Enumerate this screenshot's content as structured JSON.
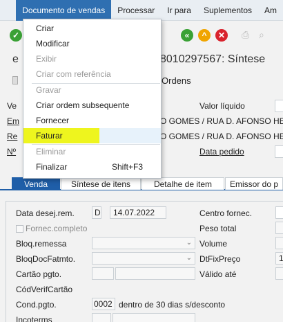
{
  "menubar": {
    "items": [
      {
        "label": "",
        "active": false
      },
      {
        "label": "Documento de vendas",
        "active": true
      },
      {
        "label": "Processar",
        "active": false
      },
      {
        "label": "Ir para",
        "active": false
      },
      {
        "label": "Suplementos",
        "active": false
      },
      {
        "label": "Am",
        "active": false
      }
    ]
  },
  "title": {
    "left": "e",
    "right": "8010297567: Síntese"
  },
  "appbar": {
    "ordens": "Ordens"
  },
  "header": {
    "valor_label": "Valor líquido",
    "emissor_value": "O GOMES / RUA D. AFONSO HE",
    "recebedor_value": "O GOMES / RUA D. AFONSO HE",
    "data_pedido_label": "Data pedido",
    "left_labels": [
      "Ve",
      "Em",
      "Re",
      "Nº"
    ]
  },
  "tabs": [
    {
      "label": "Venda"
    },
    {
      "label": "Síntese de itens"
    },
    {
      "label": "Detalhe de item"
    },
    {
      "label": "Emissor do p"
    }
  ],
  "form": {
    "data_desej_label": "Data desej.rem.",
    "data_desej_type": "D",
    "data_desej_value": "14.07.2022",
    "fornec_completo_label": "Fornec.completo",
    "bloq_remessa_label": "Bloq.remessa",
    "bloq_docfat_label": "BloqDocFatmto.",
    "cartao_label": "Cartão pgto.",
    "codverif_label": "CódVerifCartão",
    "cond_pgto_label": "Cond.pgto.",
    "cond_pgto_value": "0002",
    "cond_pgto_text": "dentro de 30 dias s/desconto",
    "incoterms_label": "Incoterms",
    "centro_label": "Centro fornec.",
    "peso_label": "Peso total",
    "volume_label": "Volume",
    "dtfix_label": "DtFixPreço",
    "dtfix_value": "1",
    "valido_label": "Válido até"
  },
  "dropdown": {
    "items": [
      {
        "label": "Criar",
        "disabled": false
      },
      {
        "label": "Modificar",
        "disabled": false
      },
      {
        "label": "Exibir",
        "disabled": true
      },
      {
        "label": "Criar com referência",
        "disabled": true
      },
      {
        "label": "Gravar",
        "disabled": true
      },
      {
        "label": "Criar ordem subsequente",
        "disabled": false
      },
      {
        "label": "Fornecer",
        "disabled": false
      },
      {
        "label": "Faturar",
        "disabled": false
      },
      {
        "label": "Eliminar",
        "disabled": true
      },
      {
        "label": "Finalizar",
        "disabled": false,
        "shortcut": "Shift+F3"
      }
    ]
  },
  "colors": {
    "menu_active": "#2f6fb1",
    "tab_active": "#1f5ea8",
    "highlight": "#eef51e"
  }
}
